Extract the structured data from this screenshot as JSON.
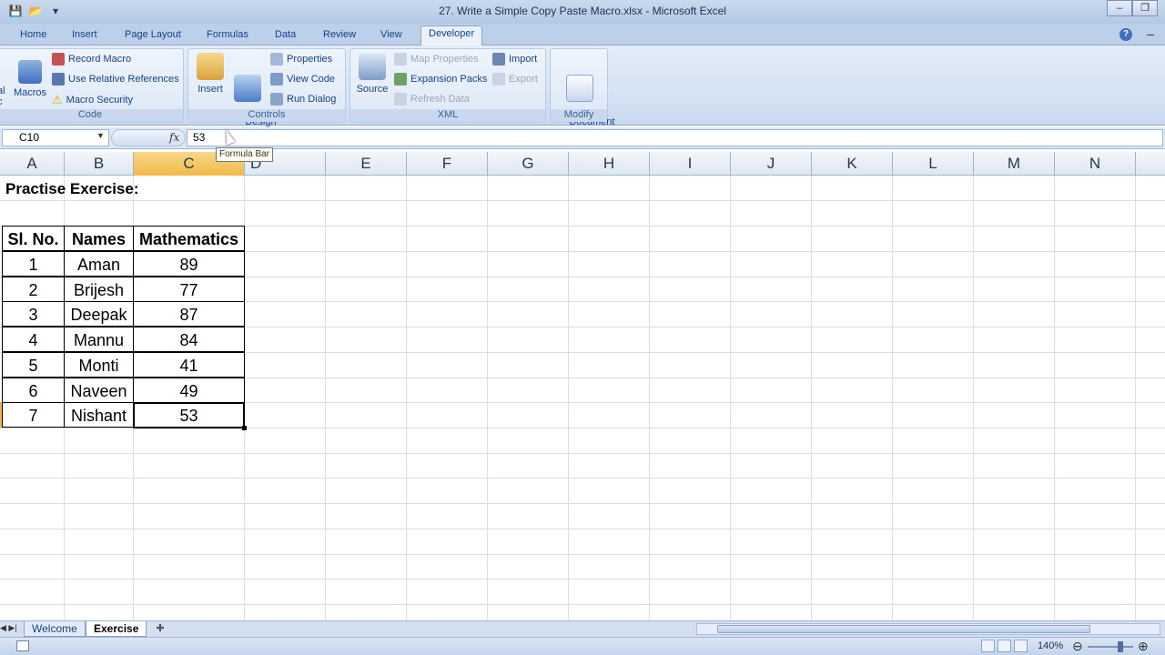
{
  "window": {
    "title": "27. Write a Simple Copy Paste Macro.xlsx - Microsoft Excel",
    "controls": [
      "–",
      "❐",
      "✕"
    ]
  },
  "ribbon_tabs": [
    "Home",
    "Insert",
    "Page Layout",
    "Formulas",
    "Data",
    "Review",
    "View",
    "Developer"
  ],
  "active_tab": "Developer",
  "ribbon": {
    "code": {
      "label": "Code",
      "visual_basic_partial": "al\nc",
      "macros": "Macros",
      "record_macro": "Record Macro",
      "use_relative": "Use Relative References",
      "macro_security": "Macro Security"
    },
    "controls": {
      "label": "Controls",
      "insert": "Insert",
      "design_mode": "Design\nMode",
      "properties": "Properties",
      "view_code": "View Code",
      "run_dialog": "Run Dialog"
    },
    "xml": {
      "label": "XML",
      "source": "Source",
      "map_properties": "Map Properties",
      "expansion_packs": "Expansion Packs",
      "refresh_data": "Refresh Data",
      "import": "Import",
      "export": "Export"
    },
    "modify": {
      "label": "Modify",
      "document_panel": "Document\nPanel"
    }
  },
  "formula_bar": {
    "name_box": "C10",
    "fx": "fx",
    "value": "53",
    "tooltip": "Formula Bar"
  },
  "columns": [
    "A",
    "B",
    "C",
    "D",
    "E",
    "F",
    "G",
    "H",
    "I",
    "J",
    "K",
    "L",
    "M",
    "N"
  ],
  "selected_column": "C",
  "sheet": {
    "heading": "Practise Exercise:",
    "table_headers": [
      "Sl. No.",
      "Names",
      "Mathematics"
    ],
    "rows": [
      [
        "1",
        "Aman",
        "89"
      ],
      [
        "2",
        "Brijesh",
        "77"
      ],
      [
        "3",
        "Deepak",
        "87"
      ],
      [
        "4",
        "Mannu",
        "84"
      ],
      [
        "5",
        "Monti",
        "41"
      ],
      [
        "6",
        "Naveen",
        "49"
      ],
      [
        "7",
        "Nishant",
        "53"
      ]
    ]
  },
  "sheet_tabs": [
    "Welcome",
    "Exercise"
  ],
  "active_sheet": "Exercise",
  "status": {
    "zoom": "140%"
  },
  "colors": {
    "ribbon_blue": "#d3e1f3",
    "selected_header": "#f1b848",
    "text_blue": "#15428b"
  }
}
